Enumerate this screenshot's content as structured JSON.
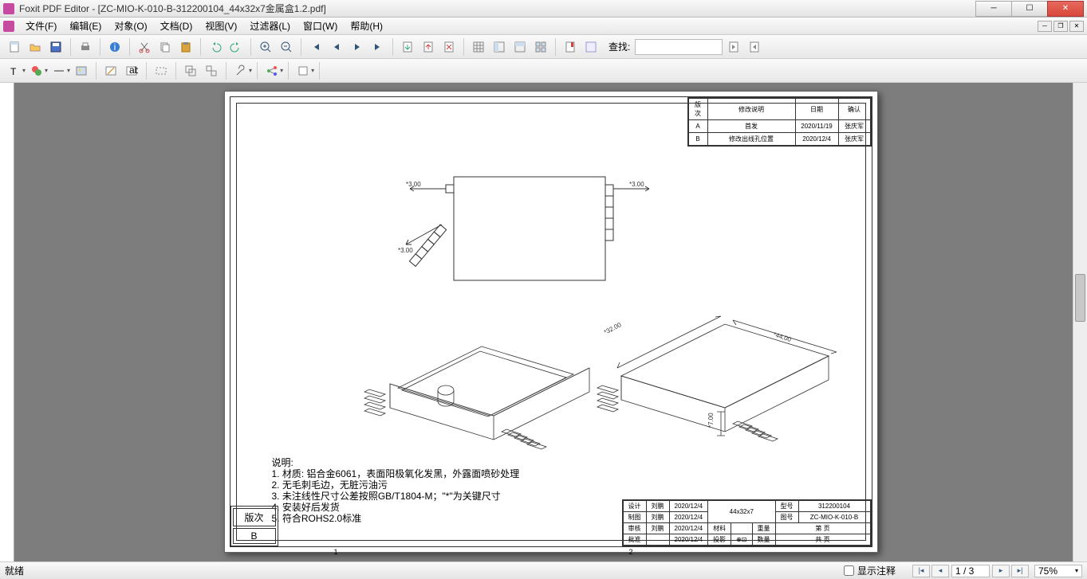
{
  "title": "Foxit PDF Editor - [ZC-MIO-K-010-B-312200104_44x32x7金属盒1.2.pdf]",
  "menu": {
    "file": "文件(F)",
    "edit": "编辑(E)",
    "object": "对象(O)",
    "doc": "文档(D)",
    "view": "视图(V)",
    "filter": "过滤器(L)",
    "window": "窗口(W)",
    "help": "帮助(H)"
  },
  "search_label": "查找: ",
  "revision_table": {
    "headers": [
      "版次",
      "修改说明",
      "日期",
      "确认"
    ],
    "rows": [
      [
        "A",
        "首发",
        "2020/11/19",
        "张庆军"
      ],
      [
        "B",
        "修改出线孔位置",
        "2020/12/4",
        "张庆军"
      ]
    ]
  },
  "dimensions": {
    "d300a": "*3.00",
    "d300b": "*3.00",
    "d300c": "*3.00",
    "d32": "*32.00",
    "d44": "*44.00",
    "d7": "*7.00"
  },
  "notes": {
    "header": "说明:",
    "l1": "1. 材质: 铝合金6061，表面阳极氧化发黑，外露面喷砂处理",
    "l2": "2. 无毛刺毛边，无脏污油污",
    "l3": "3. 未注线性尺寸公差按照GB/T1804-M；\"*\"为关键尺寸",
    "l4": "4. 安装好后发货",
    "l5": "5. 符合ROHS2.0标准"
  },
  "revblock": {
    "h": "版次",
    "v": "B"
  },
  "titleblock": {
    "design": "设计",
    "draw": "制图",
    "review": "审核",
    "approve": "批准",
    "name": "刘鹏",
    "date": "2020/12/4",
    "partname": "44x32x7",
    "model": "型号",
    "modelval": "312200104",
    "drawing": "图号",
    "drawingval": "ZC-MIO-K-010-B",
    "material": "材料",
    "weight": "重量",
    "page": "第  页",
    "project": "投影",
    "qty": "数量",
    "total": "共  页"
  },
  "pagenums": {
    "p1": "1",
    "p2": "2"
  },
  "status": {
    "ready": "就绪",
    "show_annot": "显示注释",
    "page": "1 / 3",
    "zoom": "75%"
  }
}
